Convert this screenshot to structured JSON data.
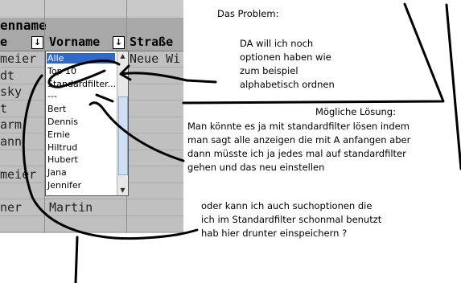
{
  "sheet": {
    "title": "enname",
    "headers": [
      {
        "label": "e",
        "dropdown": "↓"
      },
      {
        "label": "Vorname",
        "dropdown": "↓"
      },
      {
        "label": "Straße"
      }
    ],
    "rows": [
      {
        "a": "meier",
        "b": "",
        "c": "Neue Wi"
      },
      {
        "a": "dt",
        "b": "",
        "c": ""
      },
      {
        "a": "sky",
        "b": "",
        "c": ""
      },
      {
        "a": "t",
        "b": "",
        "c": ""
      },
      {
        "a": "arm",
        "b": "",
        "c": ""
      },
      {
        "a": "ann",
        "b": "",
        "c": ""
      },
      {
        "a": "",
        "b": "",
        "c": ""
      },
      {
        "a": "meier",
        "b": "",
        "c": ""
      },
      {
        "a": "",
        "b": "---",
        "c": ""
      },
      {
        "a": "ner",
        "b": "Martin",
        "c": ""
      },
      {
        "a": "",
        "b": "",
        "c": ""
      }
    ]
  },
  "filter_list": {
    "items": [
      "Alle",
      "Top 10",
      "Standardfilter...",
      "---",
      "Bert",
      "Dennis",
      "Ernie",
      "Hiltrud",
      "Hubert",
      "Jana",
      "Jennifer"
    ],
    "selected_index": 0
  },
  "notes": {
    "problem_title": "Das Problem:",
    "problem_lines": [
      "DA will ich noch",
      "optionen haben wie",
      "zum beispiel",
      "alphabetisch ordnen"
    ],
    "solution_title": "Mögliche Lösung:",
    "solution_lines": [
      "Man könnte es ja mit standardfilter lösen indem",
      "man sagt alle anzeigen die mit A anfangen aber",
      "dann müsste ich ja jedes mal auf standardfilter",
      "gehen und das neu einstellen"
    ],
    "question_lines": [
      "oder kann ich auch suchoptionen die",
      "ich im Standardfilter schonmal benutzt",
      "hab hier drunter einspeichern ?"
    ]
  },
  "colors": {
    "sheet_bg": "#c0c0c0",
    "header_bg": "#a8a8a8",
    "selection": "#3169c6",
    "ink": "#000000"
  },
  "icons": [
    "dropdown-arrow-icon",
    "scroll-up-icon",
    "scroll-down-icon"
  ]
}
